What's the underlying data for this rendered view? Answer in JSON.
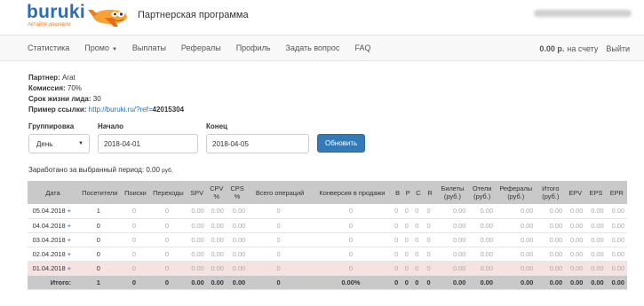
{
  "header": {
    "logo_word": "buruki",
    "logo_tagline": "летайте дешевле",
    "program_title": "Партнерская программа"
  },
  "nav": {
    "items": [
      "Статистика",
      "Промо",
      "Выплаты",
      "Рефералы",
      "Профиль",
      "Задать вопрос",
      "FAQ"
    ],
    "balance_amount": "0.00 р.",
    "balance_label": "на счету",
    "exit_label": "Выйти"
  },
  "info": {
    "partner_label": "Партнер:",
    "partner_value": "Arat",
    "commission_label": "Комиссия:",
    "commission_value": "70%",
    "lifetime_label": "Срок жизни лида:",
    "lifetime_value": "30",
    "link_label": "Пример ссылки:",
    "link_prefix": "http://buruki.ru/?ref=",
    "link_ref": "42015304"
  },
  "filters": {
    "group_label": "Группировка",
    "group_value": "День",
    "start_label": "Начало",
    "start_value": "2018-04-01",
    "end_label": "Конец",
    "end_value": "2018-04-05",
    "refresh_label": "Обновить"
  },
  "earned": {
    "label": "Заработано за выбранный период:",
    "amount": "0.00",
    "unit": "руб."
  },
  "table": {
    "headers": [
      "Дата",
      "Посетители",
      "Поиски",
      "Переходы",
      "SPV",
      "CPV %",
      "CPS %",
      "Всего операций",
      "Конверсия в продажи",
      "B",
      "P",
      "C",
      "R",
      "Билеты (руб.)",
      "Отели (руб.)",
      "Рефералы (руб.)",
      "Итого (руб.)",
      "EPV",
      "EPS",
      "EPR"
    ],
    "rows": [
      {
        "date": "05.04.2018",
        "plus": "+",
        "cells": [
          "1",
          "0",
          "0",
          "0.00",
          "0.00",
          "0.00",
          "0",
          "0",
          "0",
          "0",
          "0",
          "0",
          "0.00",
          "0.00",
          "0.00",
          "0.00",
          "0.00",
          "0.00",
          "0.00"
        ]
      },
      {
        "date": "04.04.2018",
        "plus": "+",
        "cells": [
          "0",
          "0",
          "0",
          "0.00",
          "0.00",
          "0.00",
          "0",
          "0",
          "0",
          "0",
          "0",
          "0",
          "0.00",
          "0.00",
          "0.00",
          "0.00",
          "0.00",
          "0.00",
          "0.00"
        ]
      },
      {
        "date": "03.04.2018",
        "plus": "+",
        "cells": [
          "0",
          "0",
          "0",
          "0.00",
          "0.00",
          "0.00",
          "0",
          "0",
          "0",
          "0",
          "0",
          "0",
          "0.00",
          "0.00",
          "0.00",
          "0.00",
          "0.00",
          "0.00",
          "0.00"
        ]
      },
      {
        "date": "02.04.2018",
        "plus": "+",
        "cells": [
          "0",
          "0",
          "0",
          "0.00",
          "0.00",
          "0.00",
          "0",
          "0",
          "0",
          "0",
          "0",
          "0",
          "0.00",
          "0.00",
          "0.00",
          "0.00",
          "0.00",
          "0.00",
          "0.00"
        ]
      },
      {
        "date": "01.04.2018",
        "plus": "+",
        "cells": [
          "0",
          "0",
          "0",
          "0.00",
          "0.00",
          "0.00",
          "0",
          "0",
          "0",
          "0",
          "0",
          "0",
          "0.00",
          "0.00",
          "0.00",
          "0.00",
          "0.00",
          "0.00",
          "0.00"
        ]
      }
    ],
    "total": {
      "label": "Итого:",
      "cells": [
        "1",
        "0",
        "0",
        "0.00",
        "0.00",
        "0.00",
        "0",
        "0.00%",
        "0",
        "0",
        "0",
        "0",
        "0.00",
        "0.00",
        "0.00",
        "0.00",
        "0.00",
        "0.00",
        "0.00"
      ]
    }
  },
  "colors": {
    "brand_blue": "#2a6db6",
    "brand_orange": "#f07c1d",
    "button_blue": "#337ab7",
    "highlight_row": "#f7e2e2"
  }
}
